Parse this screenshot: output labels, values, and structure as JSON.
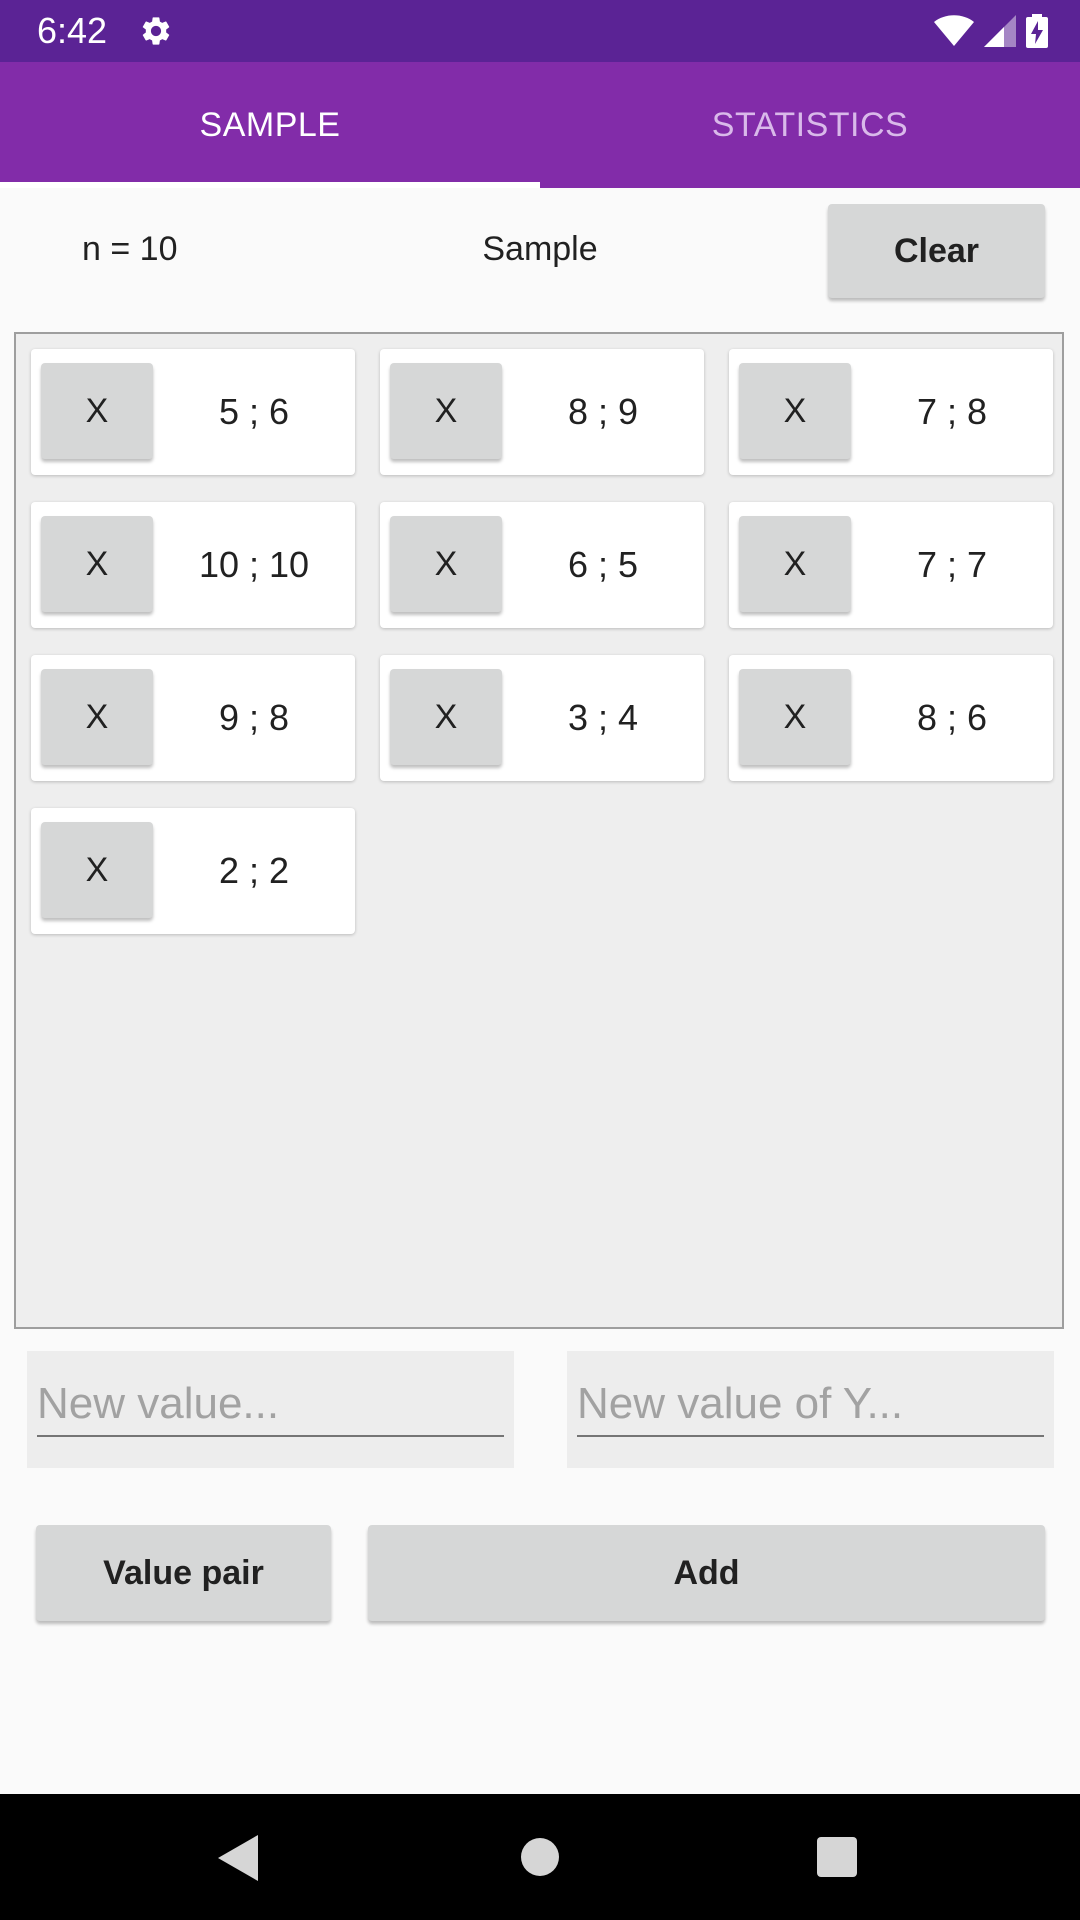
{
  "status_bar": {
    "time": "6:42",
    "icons": [
      "settings-gear-icon",
      "wifi-icon",
      "cellular-signal-icon",
      "battery-charging-icon"
    ]
  },
  "tabs": [
    {
      "label": "SAMPLE",
      "selected": true
    },
    {
      "label": "STATISTICS",
      "selected": false
    }
  ],
  "header": {
    "count_label": "n = 10",
    "title": "Sample",
    "clear_label": "Clear"
  },
  "samples": [
    {
      "remove_label": "X",
      "value": "5 ; 6"
    },
    {
      "remove_label": "X",
      "value": "8 ; 9"
    },
    {
      "remove_label": "X",
      "value": "7 ; 8"
    },
    {
      "remove_label": "X",
      "value": "10 ; 10"
    },
    {
      "remove_label": "X",
      "value": "6 ; 5"
    },
    {
      "remove_label": "X",
      "value": "7 ; 7"
    },
    {
      "remove_label": "X",
      "value": "9 ; 8"
    },
    {
      "remove_label": "X",
      "value": "3 ; 4"
    },
    {
      "remove_label": "X",
      "value": "8 ; 6"
    },
    {
      "remove_label": "X",
      "value": "2 ; 2"
    }
  ],
  "inputs": {
    "x_placeholder": "New value...",
    "x_value": "",
    "y_placeholder": "New value of Y...",
    "y_value": ""
  },
  "actions": {
    "mode_label": "Value pair",
    "add_label": "Add"
  },
  "colors": {
    "status_bar": "#5b2395",
    "app_bar": "#822ca9",
    "button": "#d6d7d7",
    "panel": "#eeeeee"
  }
}
